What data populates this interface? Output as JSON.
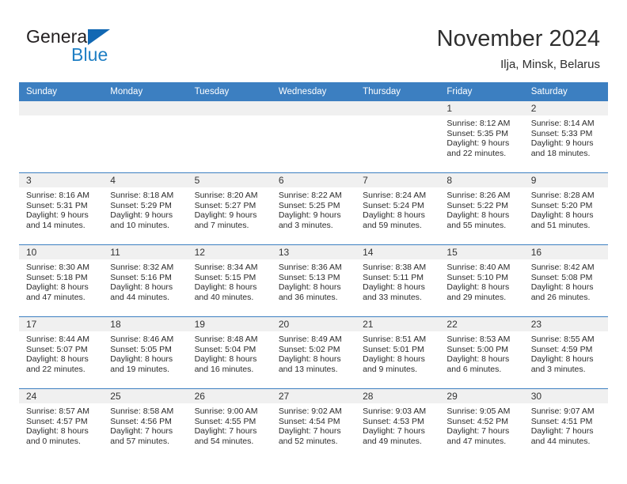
{
  "brand": {
    "name_dark": "General",
    "name_blue": "Blue",
    "accent_color": "#1f7fc4",
    "triangle_color": "#1268b3"
  },
  "header": {
    "title": "November 2024",
    "subtitle": "Ilja, Minsk, Belarus"
  },
  "calendar": {
    "header_bg": "#3c7fc1",
    "daynum_bg": "#f0f0f0",
    "weekdays": [
      "Sunday",
      "Monday",
      "Tuesday",
      "Wednesday",
      "Thursday",
      "Friday",
      "Saturday"
    ],
    "weeks": [
      [
        {
          "day": "",
          "sunrise": "",
          "sunset": "",
          "daylight1": "",
          "daylight2": ""
        },
        {
          "day": "",
          "sunrise": "",
          "sunset": "",
          "daylight1": "",
          "daylight2": ""
        },
        {
          "day": "",
          "sunrise": "",
          "sunset": "",
          "daylight1": "",
          "daylight2": ""
        },
        {
          "day": "",
          "sunrise": "",
          "sunset": "",
          "daylight1": "",
          "daylight2": ""
        },
        {
          "day": "",
          "sunrise": "",
          "sunset": "",
          "daylight1": "",
          "daylight2": ""
        },
        {
          "day": "1",
          "sunrise": "Sunrise: 8:12 AM",
          "sunset": "Sunset: 5:35 PM",
          "daylight1": "Daylight: 9 hours",
          "daylight2": "and 22 minutes."
        },
        {
          "day": "2",
          "sunrise": "Sunrise: 8:14 AM",
          "sunset": "Sunset: 5:33 PM",
          "daylight1": "Daylight: 9 hours",
          "daylight2": "and 18 minutes."
        }
      ],
      [
        {
          "day": "3",
          "sunrise": "Sunrise: 8:16 AM",
          "sunset": "Sunset: 5:31 PM",
          "daylight1": "Daylight: 9 hours",
          "daylight2": "and 14 minutes."
        },
        {
          "day": "4",
          "sunrise": "Sunrise: 8:18 AM",
          "sunset": "Sunset: 5:29 PM",
          "daylight1": "Daylight: 9 hours",
          "daylight2": "and 10 minutes."
        },
        {
          "day": "5",
          "sunrise": "Sunrise: 8:20 AM",
          "sunset": "Sunset: 5:27 PM",
          "daylight1": "Daylight: 9 hours",
          "daylight2": "and 7 minutes."
        },
        {
          "day": "6",
          "sunrise": "Sunrise: 8:22 AM",
          "sunset": "Sunset: 5:25 PM",
          "daylight1": "Daylight: 9 hours",
          "daylight2": "and 3 minutes."
        },
        {
          "day": "7",
          "sunrise": "Sunrise: 8:24 AM",
          "sunset": "Sunset: 5:24 PM",
          "daylight1": "Daylight: 8 hours",
          "daylight2": "and 59 minutes."
        },
        {
          "day": "8",
          "sunrise": "Sunrise: 8:26 AM",
          "sunset": "Sunset: 5:22 PM",
          "daylight1": "Daylight: 8 hours",
          "daylight2": "and 55 minutes."
        },
        {
          "day": "9",
          "sunrise": "Sunrise: 8:28 AM",
          "sunset": "Sunset: 5:20 PM",
          "daylight1": "Daylight: 8 hours",
          "daylight2": "and 51 minutes."
        }
      ],
      [
        {
          "day": "10",
          "sunrise": "Sunrise: 8:30 AM",
          "sunset": "Sunset: 5:18 PM",
          "daylight1": "Daylight: 8 hours",
          "daylight2": "and 47 minutes."
        },
        {
          "day": "11",
          "sunrise": "Sunrise: 8:32 AM",
          "sunset": "Sunset: 5:16 PM",
          "daylight1": "Daylight: 8 hours",
          "daylight2": "and 44 minutes."
        },
        {
          "day": "12",
          "sunrise": "Sunrise: 8:34 AM",
          "sunset": "Sunset: 5:15 PM",
          "daylight1": "Daylight: 8 hours",
          "daylight2": "and 40 minutes."
        },
        {
          "day": "13",
          "sunrise": "Sunrise: 8:36 AM",
          "sunset": "Sunset: 5:13 PM",
          "daylight1": "Daylight: 8 hours",
          "daylight2": "and 36 minutes."
        },
        {
          "day": "14",
          "sunrise": "Sunrise: 8:38 AM",
          "sunset": "Sunset: 5:11 PM",
          "daylight1": "Daylight: 8 hours",
          "daylight2": "and 33 minutes."
        },
        {
          "day": "15",
          "sunrise": "Sunrise: 8:40 AM",
          "sunset": "Sunset: 5:10 PM",
          "daylight1": "Daylight: 8 hours",
          "daylight2": "and 29 minutes."
        },
        {
          "day": "16",
          "sunrise": "Sunrise: 8:42 AM",
          "sunset": "Sunset: 5:08 PM",
          "daylight1": "Daylight: 8 hours",
          "daylight2": "and 26 minutes."
        }
      ],
      [
        {
          "day": "17",
          "sunrise": "Sunrise: 8:44 AM",
          "sunset": "Sunset: 5:07 PM",
          "daylight1": "Daylight: 8 hours",
          "daylight2": "and 22 minutes."
        },
        {
          "day": "18",
          "sunrise": "Sunrise: 8:46 AM",
          "sunset": "Sunset: 5:05 PM",
          "daylight1": "Daylight: 8 hours",
          "daylight2": "and 19 minutes."
        },
        {
          "day": "19",
          "sunrise": "Sunrise: 8:48 AM",
          "sunset": "Sunset: 5:04 PM",
          "daylight1": "Daylight: 8 hours",
          "daylight2": "and 16 minutes."
        },
        {
          "day": "20",
          "sunrise": "Sunrise: 8:49 AM",
          "sunset": "Sunset: 5:02 PM",
          "daylight1": "Daylight: 8 hours",
          "daylight2": "and 13 minutes."
        },
        {
          "day": "21",
          "sunrise": "Sunrise: 8:51 AM",
          "sunset": "Sunset: 5:01 PM",
          "daylight1": "Daylight: 8 hours",
          "daylight2": "and 9 minutes."
        },
        {
          "day": "22",
          "sunrise": "Sunrise: 8:53 AM",
          "sunset": "Sunset: 5:00 PM",
          "daylight1": "Daylight: 8 hours",
          "daylight2": "and 6 minutes."
        },
        {
          "day": "23",
          "sunrise": "Sunrise: 8:55 AM",
          "sunset": "Sunset: 4:59 PM",
          "daylight1": "Daylight: 8 hours",
          "daylight2": "and 3 minutes."
        }
      ],
      [
        {
          "day": "24",
          "sunrise": "Sunrise: 8:57 AM",
          "sunset": "Sunset: 4:57 PM",
          "daylight1": "Daylight: 8 hours",
          "daylight2": "and 0 minutes."
        },
        {
          "day": "25",
          "sunrise": "Sunrise: 8:58 AM",
          "sunset": "Sunset: 4:56 PM",
          "daylight1": "Daylight: 7 hours",
          "daylight2": "and 57 minutes."
        },
        {
          "day": "26",
          "sunrise": "Sunrise: 9:00 AM",
          "sunset": "Sunset: 4:55 PM",
          "daylight1": "Daylight: 7 hours",
          "daylight2": "and 54 minutes."
        },
        {
          "day": "27",
          "sunrise": "Sunrise: 9:02 AM",
          "sunset": "Sunset: 4:54 PM",
          "daylight1": "Daylight: 7 hours",
          "daylight2": "and 52 minutes."
        },
        {
          "day": "28",
          "sunrise": "Sunrise: 9:03 AM",
          "sunset": "Sunset: 4:53 PM",
          "daylight1": "Daylight: 7 hours",
          "daylight2": "and 49 minutes."
        },
        {
          "day": "29",
          "sunrise": "Sunrise: 9:05 AM",
          "sunset": "Sunset: 4:52 PM",
          "daylight1": "Daylight: 7 hours",
          "daylight2": "and 47 minutes."
        },
        {
          "day": "30",
          "sunrise": "Sunrise: 9:07 AM",
          "sunset": "Sunset: 4:51 PM",
          "daylight1": "Daylight: 7 hours",
          "daylight2": "and 44 minutes."
        }
      ]
    ]
  }
}
